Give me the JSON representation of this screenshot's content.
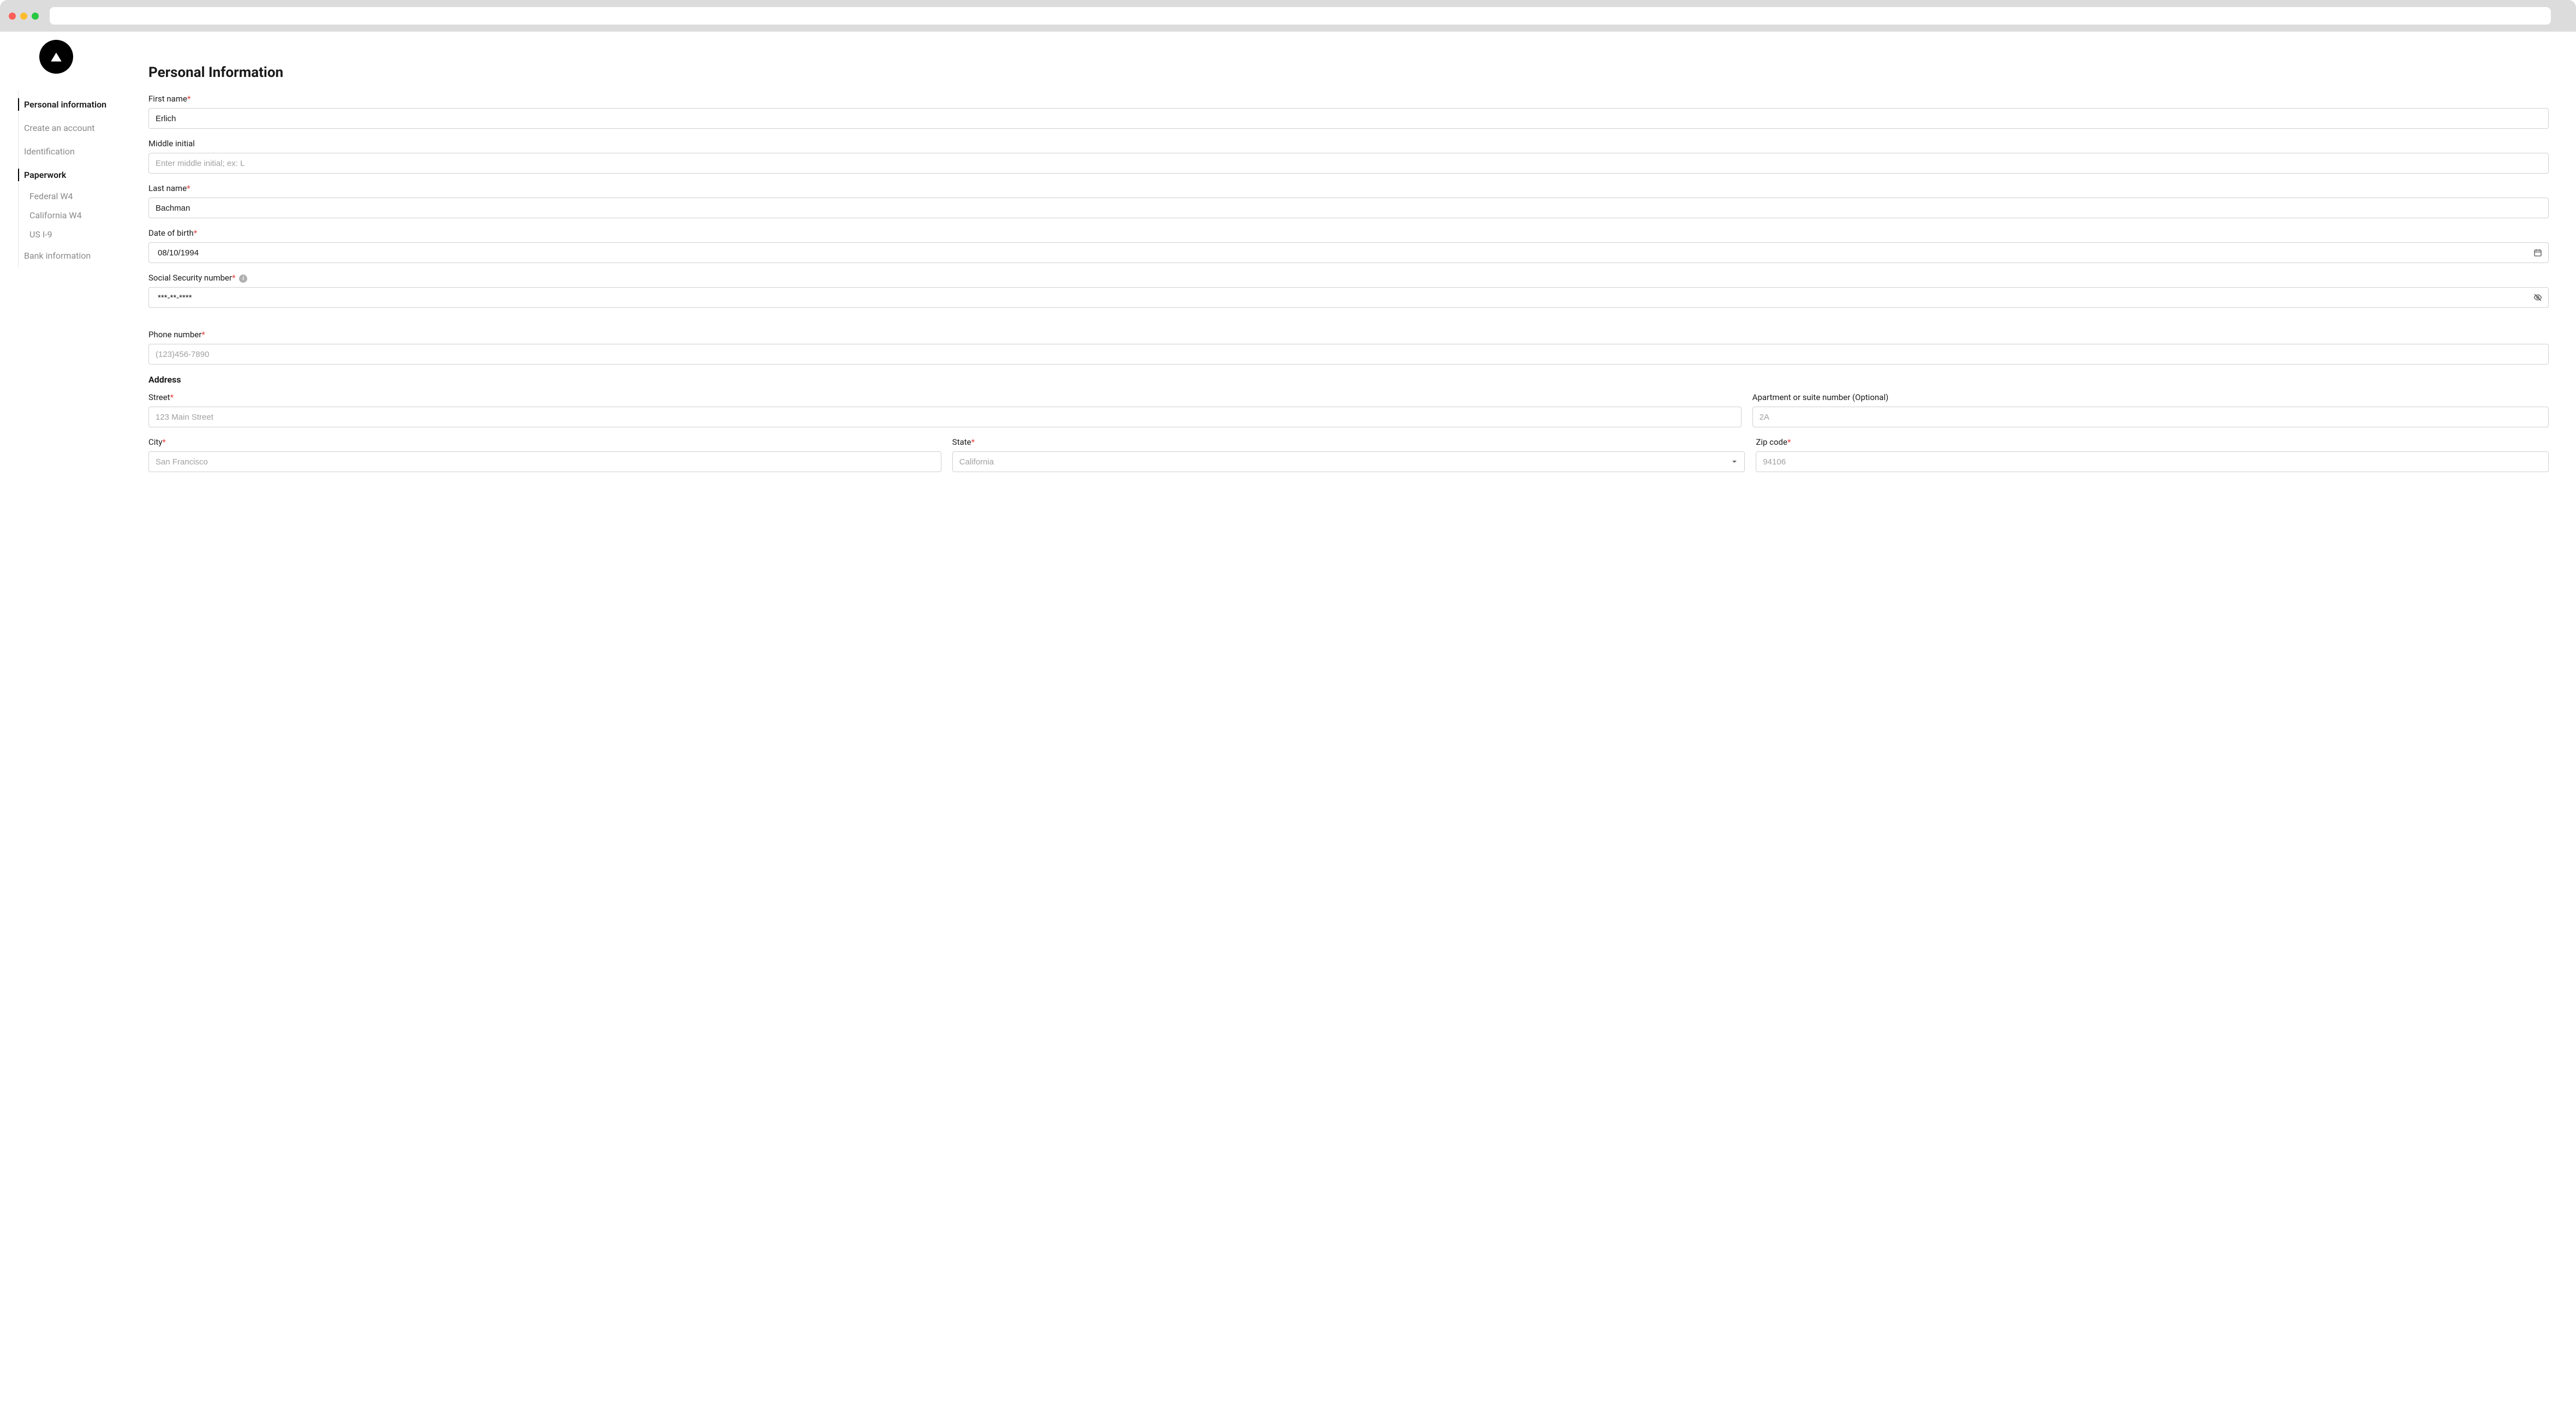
{
  "sidebar": {
    "items": [
      {
        "label": "Personal information",
        "type": "section"
      },
      {
        "label": "Create an account",
        "type": "item"
      },
      {
        "label": "Identification",
        "type": "item"
      },
      {
        "label": "Paperwork",
        "type": "section"
      },
      {
        "label": "Federal W4",
        "type": "sub"
      },
      {
        "label": "California W4",
        "type": "sub"
      },
      {
        "label": "US I-9",
        "type": "sub"
      },
      {
        "label": "Bank information",
        "type": "item"
      }
    ]
  },
  "page": {
    "title": "Personal Information"
  },
  "form": {
    "first_name": {
      "label": "First name",
      "value": "Erlich",
      "required": true
    },
    "middle_initial": {
      "label": "Middle initial",
      "value": "",
      "placeholder": "Enter middle initial; ex: L",
      "required": false
    },
    "last_name": {
      "label": "Last name",
      "value": "Bachman",
      "required": true
    },
    "dob": {
      "label": "Date of birth",
      "value": "08/10/1994",
      "required": true
    },
    "ssn": {
      "label": "Social Security number",
      "value": "***-**-****",
      "required": true
    },
    "phone": {
      "label": "Phone number",
      "value": "",
      "placeholder": "(123)456-7890",
      "required": true
    },
    "address_heading": "Address",
    "street": {
      "label": "Street",
      "value": "",
      "placeholder": "123 Main Street",
      "required": true
    },
    "apartment": {
      "label": "Apartment or suite number (Optional)",
      "value": "",
      "placeholder": "2A",
      "required": false
    },
    "city": {
      "label": "City",
      "value": "",
      "placeholder": "San Francisco",
      "required": true
    },
    "state": {
      "label": "State",
      "value": "",
      "placeholder": "California",
      "required": true
    },
    "zip": {
      "label": "Zip code",
      "value": "",
      "placeholder": "94106",
      "required": true
    }
  }
}
